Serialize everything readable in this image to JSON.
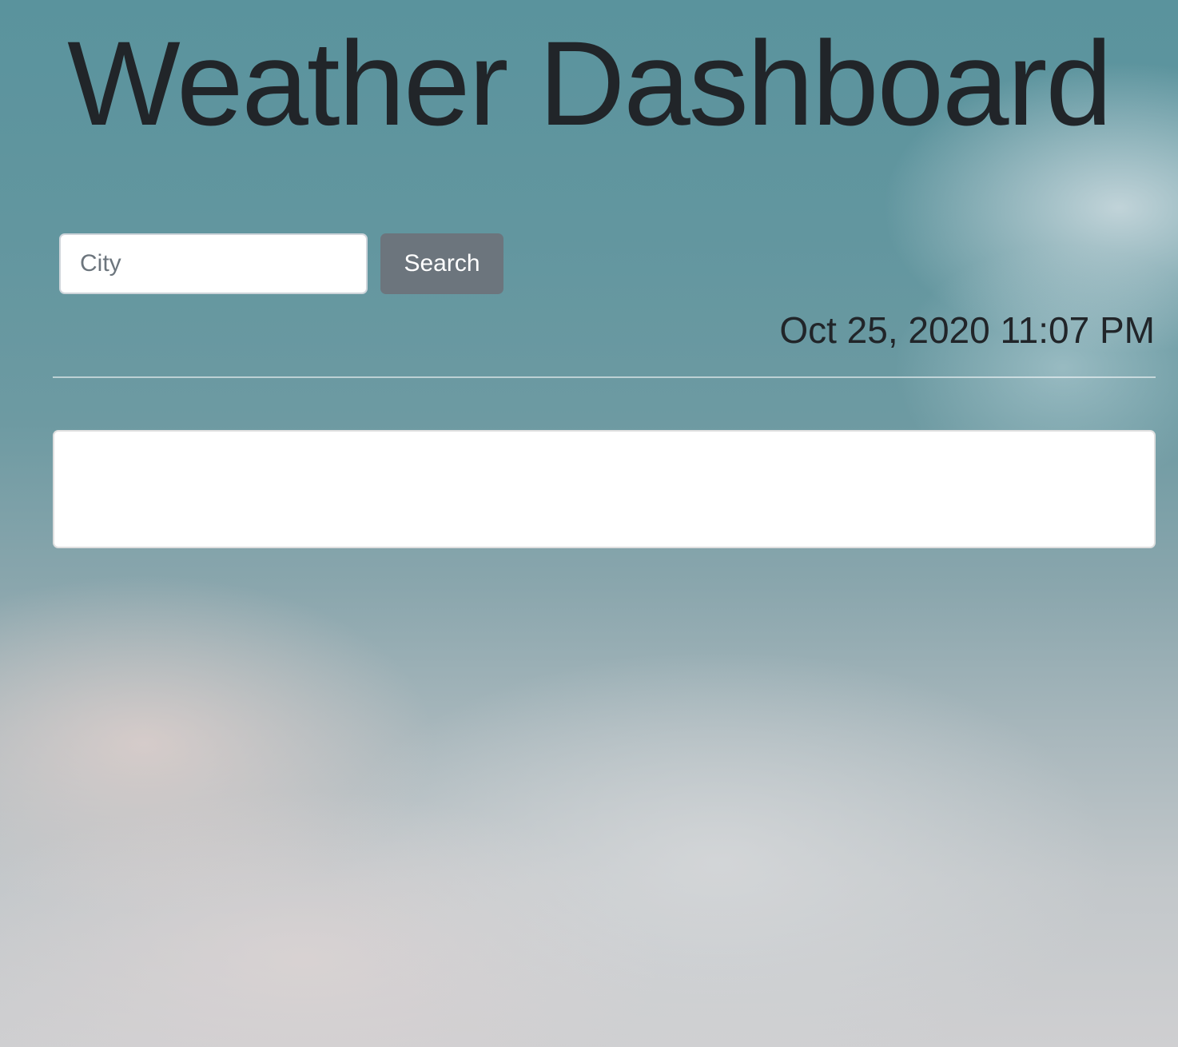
{
  "header": {
    "title": "Weather Dashboard"
  },
  "search": {
    "placeholder": "City",
    "value": "",
    "button_label": "Search"
  },
  "datetime": "Oct 25, 2020 11:07 PM",
  "results": {
    "content": ""
  },
  "colors": {
    "text": "#212529",
    "button_bg": "#6c757d",
    "button_text": "#ffffff",
    "panel_bg": "#ffffff",
    "sky_teal": "#5a939d",
    "sky_cloud": "#cfcfd1"
  }
}
